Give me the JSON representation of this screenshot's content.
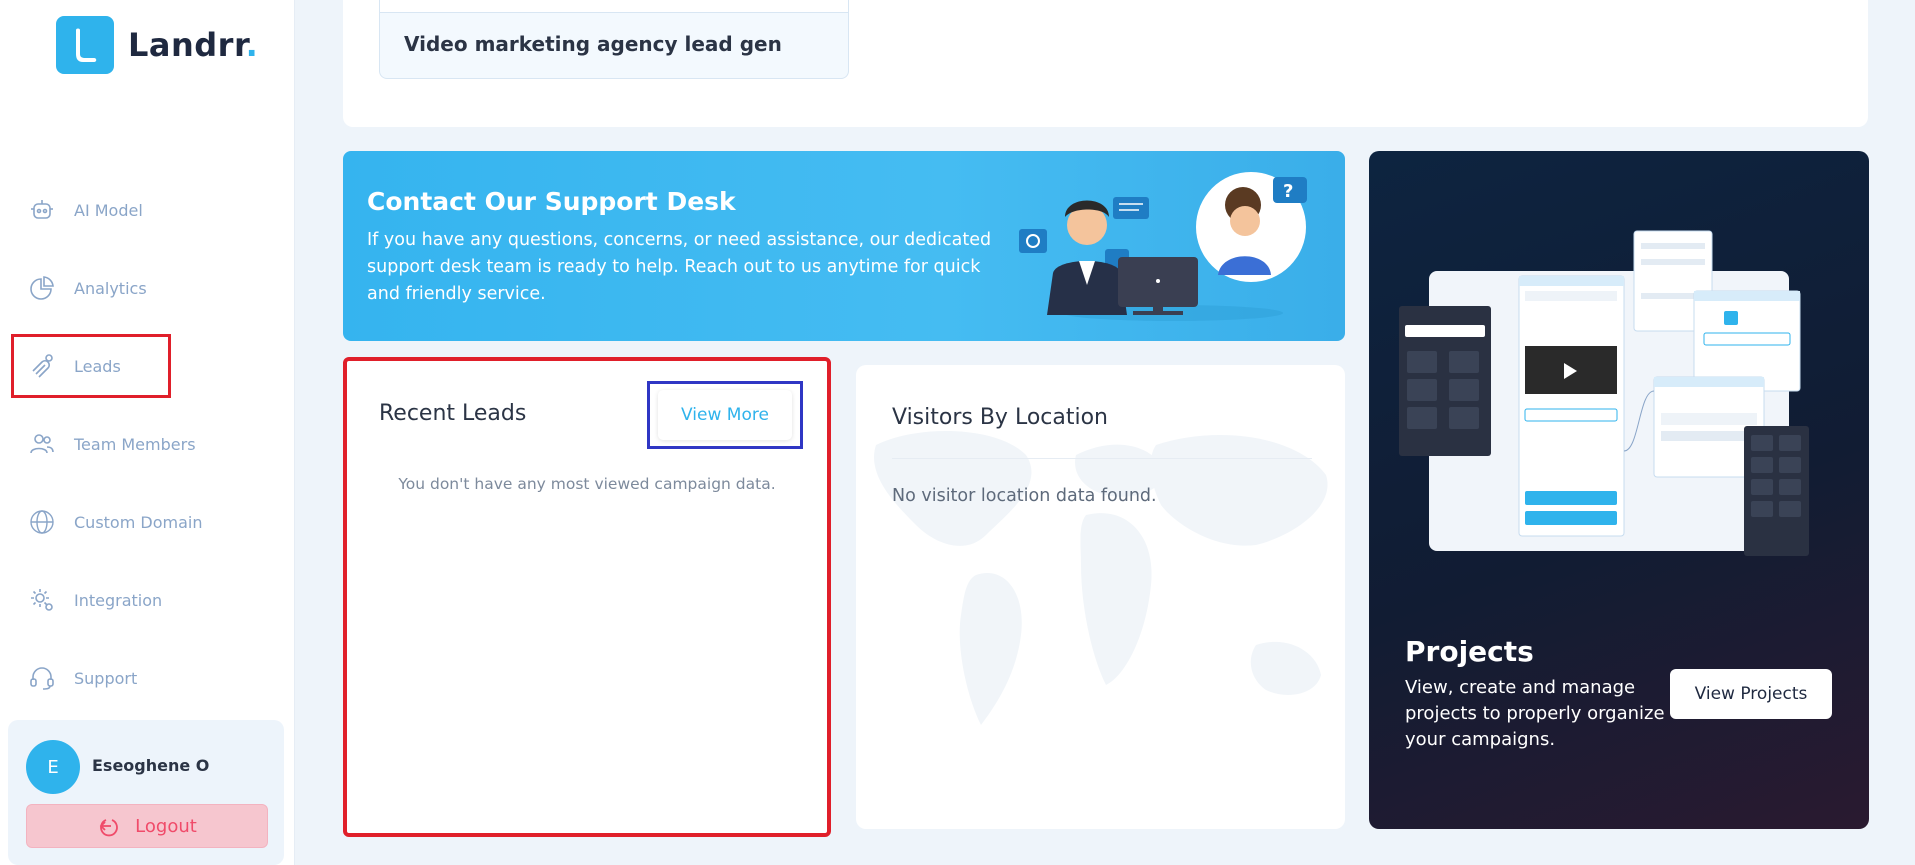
{
  "brand": {
    "name": "Landrr",
    "dot": ".",
    "colors": {
      "accent": "#2fb3ec",
      "text": "#1f2940"
    }
  },
  "sidebar": {
    "items": [
      {
        "label": "AI Model",
        "icon": "robot-icon"
      },
      {
        "label": "Analytics",
        "icon": "pie-chart-icon"
      },
      {
        "label": "Leads",
        "icon": "magnet-icon"
      },
      {
        "label": "Team Members",
        "icon": "users-icon"
      },
      {
        "label": "Custom Domain",
        "icon": "globe-www-icon"
      },
      {
        "label": "Integration",
        "icon": "gear-integration-icon"
      },
      {
        "label": "Support",
        "icon": "headset-icon"
      }
    ]
  },
  "user": {
    "initial": "E",
    "name": "Eseoghene O",
    "logout_label": "Logout"
  },
  "top_card": {
    "campaign_title": "Video marketing agency lead gen"
  },
  "support": {
    "title": "Contact Our Support Desk",
    "text": "If you have any questions, concerns, or need assistance, our dedicated support desk team is ready to help. Reach out to us anytime for quick and friendly service."
  },
  "projects": {
    "title": "Projects",
    "text": "View, create and manage projects to properly organize your campaigns.",
    "button_label": "View Projects"
  },
  "leads": {
    "title": "Recent Leads",
    "view_more_label": "View More",
    "empty_text": "You don't have any most viewed campaign data."
  },
  "visitors": {
    "title": "Visitors By Location",
    "empty_text": "No visitor location data found."
  }
}
